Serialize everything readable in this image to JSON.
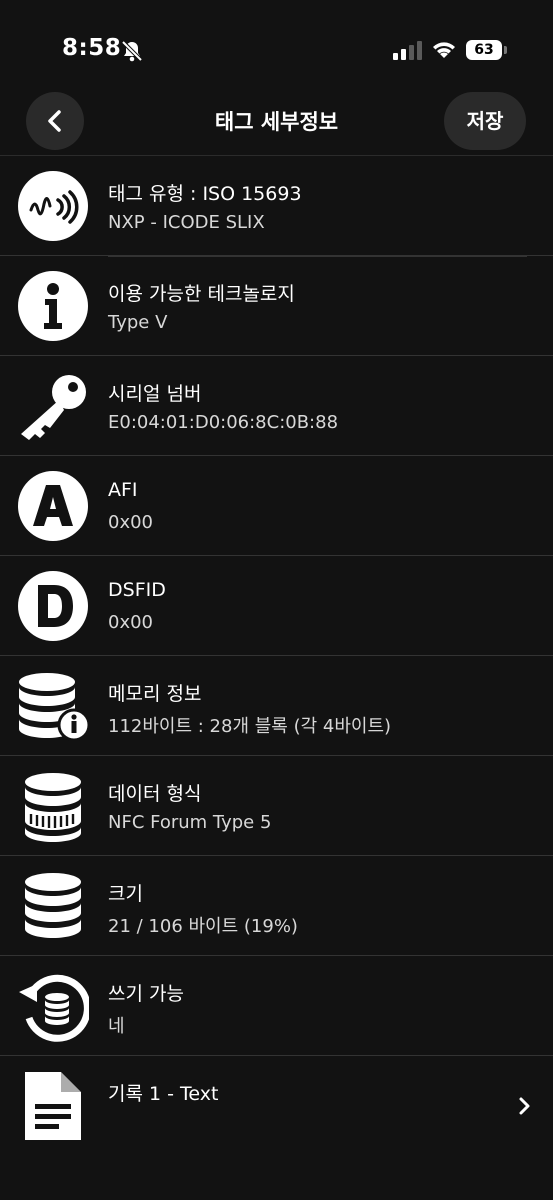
{
  "status": {
    "time": "8:58",
    "battery": "63"
  },
  "nav": {
    "title": "태그 세부정보",
    "save_label": "저장"
  },
  "rows": [
    {
      "title": "태그 유형 : ISO 15693",
      "sub": "NXP - ICODE SLIX",
      "icon": "nfc-icon"
    },
    {
      "title": "이용 가능한 테크놀로지",
      "sub": "Type V",
      "icon": "info-icon"
    },
    {
      "title": "시리얼 넘버",
      "sub": "E0:04:01:D0:06:8C:0B:88",
      "icon": "key-icon"
    },
    {
      "title": "AFI",
      "sub": "0x00",
      "icon": "letter-a-icon"
    },
    {
      "title": "DSFID",
      "sub": "0x00",
      "icon": "letter-d-icon"
    },
    {
      "title": "메모리 정보",
      "sub": "112바이트 : 28개 블록 (각 4바이트)",
      "icon": "database-info-icon"
    },
    {
      "title": "데이터 형식",
      "sub": "NFC Forum Type 5",
      "icon": "database-format-icon"
    },
    {
      "title": "크기",
      "sub": "21 / 106 바이트 (19%)",
      "icon": "database-icon"
    },
    {
      "title": "쓰기 가능",
      "sub": "네",
      "icon": "database-refresh-icon"
    },
    {
      "title": "기록 1 - Text",
      "sub": "",
      "icon": "document-icon"
    }
  ]
}
